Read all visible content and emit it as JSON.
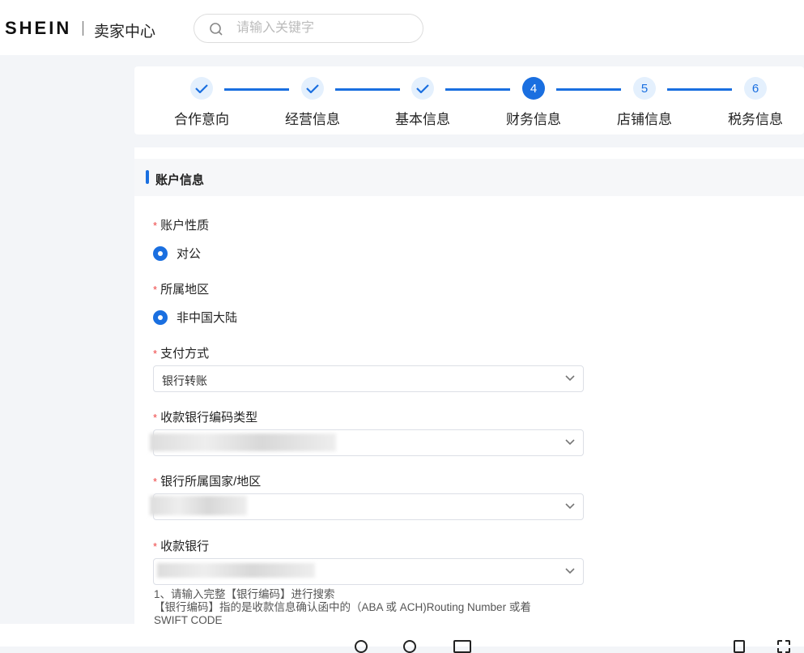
{
  "header": {
    "logo": "SHEIN",
    "subtitle": "卖家中心",
    "search_placeholder": "请输入关键字"
  },
  "steps": [
    {
      "label": "合作意向",
      "status": "done"
    },
    {
      "label": "经营信息",
      "status": "done"
    },
    {
      "label": "基本信息",
      "status": "done"
    },
    {
      "label": "财务信息",
      "status": "current",
      "num": "4"
    },
    {
      "label": "店铺信息",
      "status": "todo",
      "num": "5"
    },
    {
      "label": "税务信息",
      "status": "todo",
      "num": "6"
    }
  ],
  "section": {
    "title": "账户信息"
  },
  "form": {
    "account_type": {
      "label": "账户性质",
      "value": "对公"
    },
    "region": {
      "label": "所属地区",
      "value": "非中国大陆"
    },
    "payment": {
      "label": "支付方式",
      "value": "银行转账"
    },
    "bank_code_type": {
      "label": "收款银行编码类型"
    },
    "bank_country": {
      "label": "银行所属国家/地区"
    },
    "bank": {
      "label": "收款银行"
    },
    "hint1": "1、请输入完整【银行编码】进行搜索",
    "hint2": "【银行编码】指的是收款信息确认函中的（ABA 或 ACH)Routing Number 或着",
    "hint3": "SWIFT CODE"
  },
  "colors": {
    "accent": "#1a6fe0",
    "required": "#e44444"
  }
}
